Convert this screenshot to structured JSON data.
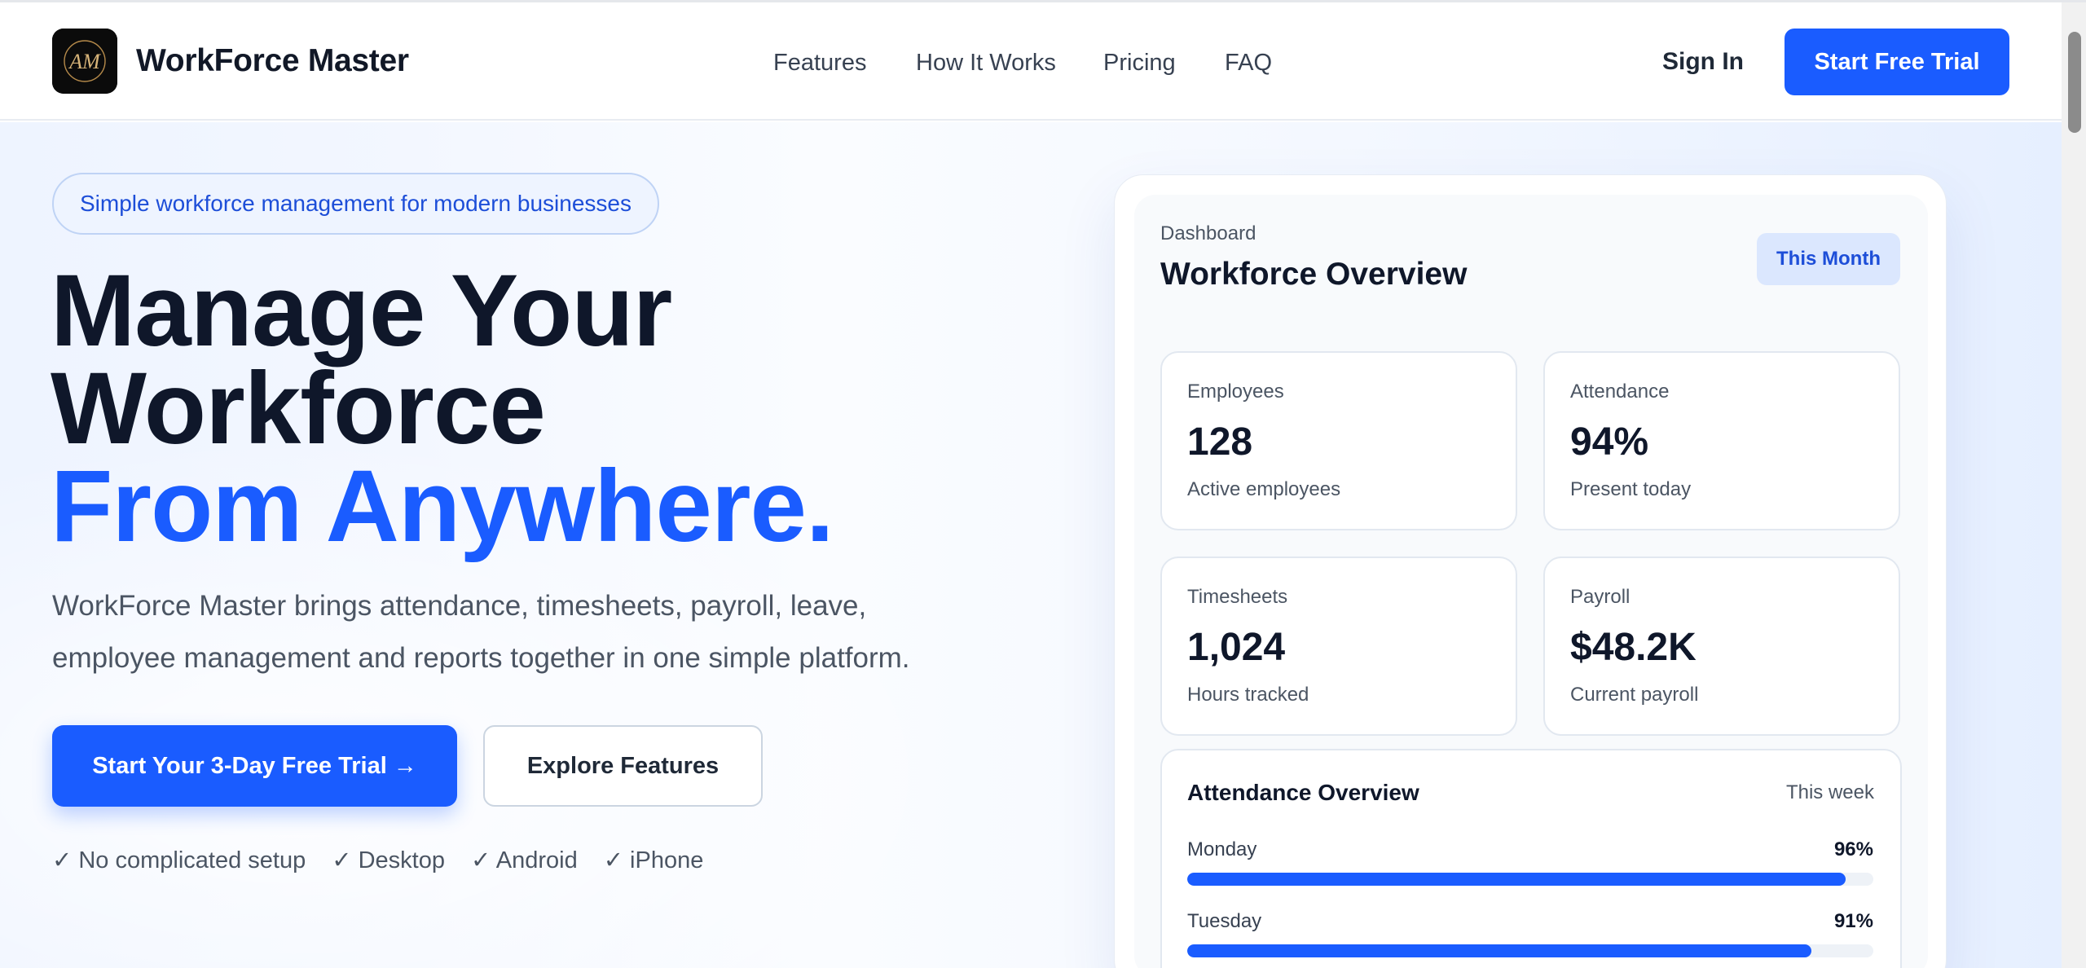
{
  "header": {
    "logo_text": "AM",
    "brand": "WorkForce Master",
    "nav": [
      {
        "label": "Features"
      },
      {
        "label": "How It Works"
      },
      {
        "label": "Pricing"
      },
      {
        "label": "FAQ"
      }
    ],
    "signin_label": "Sign In",
    "cta_label": "Start Free Trial"
  },
  "hero": {
    "pill": "Simple workforce management for modern businesses",
    "headline_line1": "Manage Your",
    "headline_line2": "Workforce",
    "headline_line3": "From Anywhere.",
    "subcopy": "WorkForce Master brings attendance, timesheets, payroll, leave, employee management and reports together in one simple platform.",
    "primary_button": "Start Your 3-Day Free Trial →",
    "secondary_button": "Explore Features",
    "features": [
      "✓ No complicated setup",
      "✓ Desktop",
      "✓ Android",
      "✓ iPhone"
    ]
  },
  "dashboard": {
    "label": "Dashboard",
    "title": "Workforce Overview",
    "period_badge": "This Month",
    "stats": [
      {
        "label": "Employees",
        "value": "128",
        "sub": "Active employees"
      },
      {
        "label": "Attendance",
        "value": "94%",
        "sub": "Present today"
      },
      {
        "label": "Timesheets",
        "value": "1,024",
        "sub": "Hours tracked"
      },
      {
        "label": "Payroll",
        "value": "$48.2K",
        "sub": "Current payroll"
      }
    ],
    "attendance": {
      "title": "Attendance Overview",
      "period": "This week",
      "days": [
        {
          "day": "Monday",
          "percent_label": "96%",
          "percent": 96
        },
        {
          "day": "Tuesday",
          "percent_label": "91%",
          "percent": 91
        }
      ]
    }
  },
  "colors": {
    "accent": "#1a5cff",
    "text_dark": "#0f172a",
    "text_muted": "#4b5563"
  }
}
